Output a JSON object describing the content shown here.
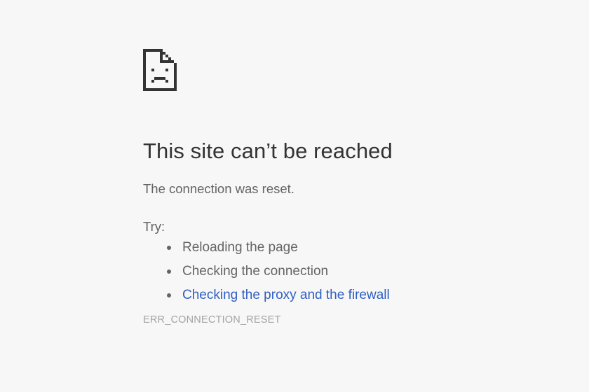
{
  "icon": "sad-page-icon",
  "title": "This site can’t be reached",
  "summary": "The connection was reset.",
  "try_label": "Try:",
  "suggestions": [
    {
      "text": "Reloading the page",
      "link": false
    },
    {
      "text": "Checking the connection",
      "link": false
    },
    {
      "text": "Checking the proxy and the firewall",
      "link": true
    }
  ],
  "error_code": "ERR_CONNECTION_RESET",
  "colors": {
    "background": "#f7f7f7",
    "title": "#333333",
    "body_text": "#646464",
    "link": "#2f5fc1",
    "error_code": "#a3a3a3"
  }
}
